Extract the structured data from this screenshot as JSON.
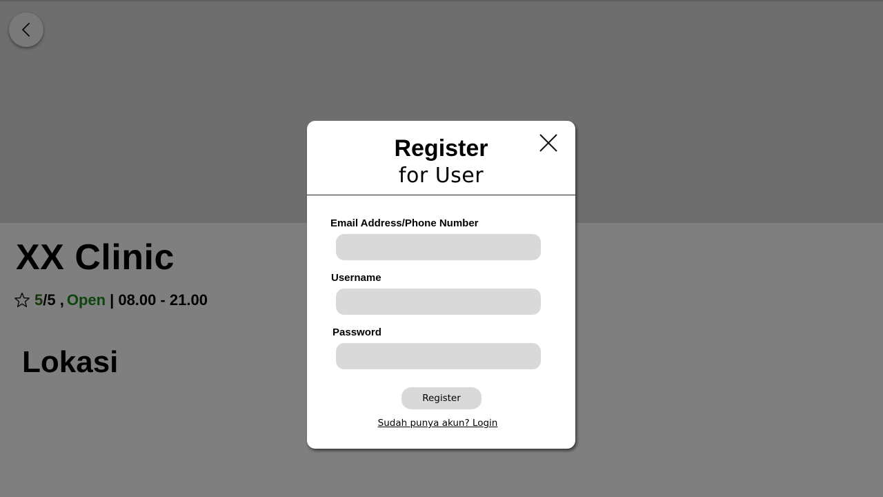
{
  "clinic": {
    "name": "XX Clinic",
    "rating_score": "5",
    "rating_max": "/5 ,",
    "status": "Open",
    "hours": "| 08.00 - 21.00"
  },
  "sections": {
    "location_title": "Lokasi"
  },
  "modal": {
    "title": "Register",
    "subtitle": "for User",
    "fields": [
      {
        "label": "Email Address/Phone Number",
        "value": "",
        "placeholder": ""
      },
      {
        "label": "Username",
        "value": "",
        "placeholder": ""
      },
      {
        "label": "Password",
        "value": "",
        "placeholder": ""
      }
    ],
    "register_label": "Register",
    "login_link": "Sudah punya akun? Login"
  },
  "icons": {
    "back": "chevron-left-icon",
    "rating": "star-outline-icon",
    "close": "close-icon"
  },
  "colors": {
    "rating_score": "#2f6b1a",
    "open_status": "#1a8a1a",
    "input_background": "#d9d9d9",
    "hero_background": "#dcdcdc"
  }
}
